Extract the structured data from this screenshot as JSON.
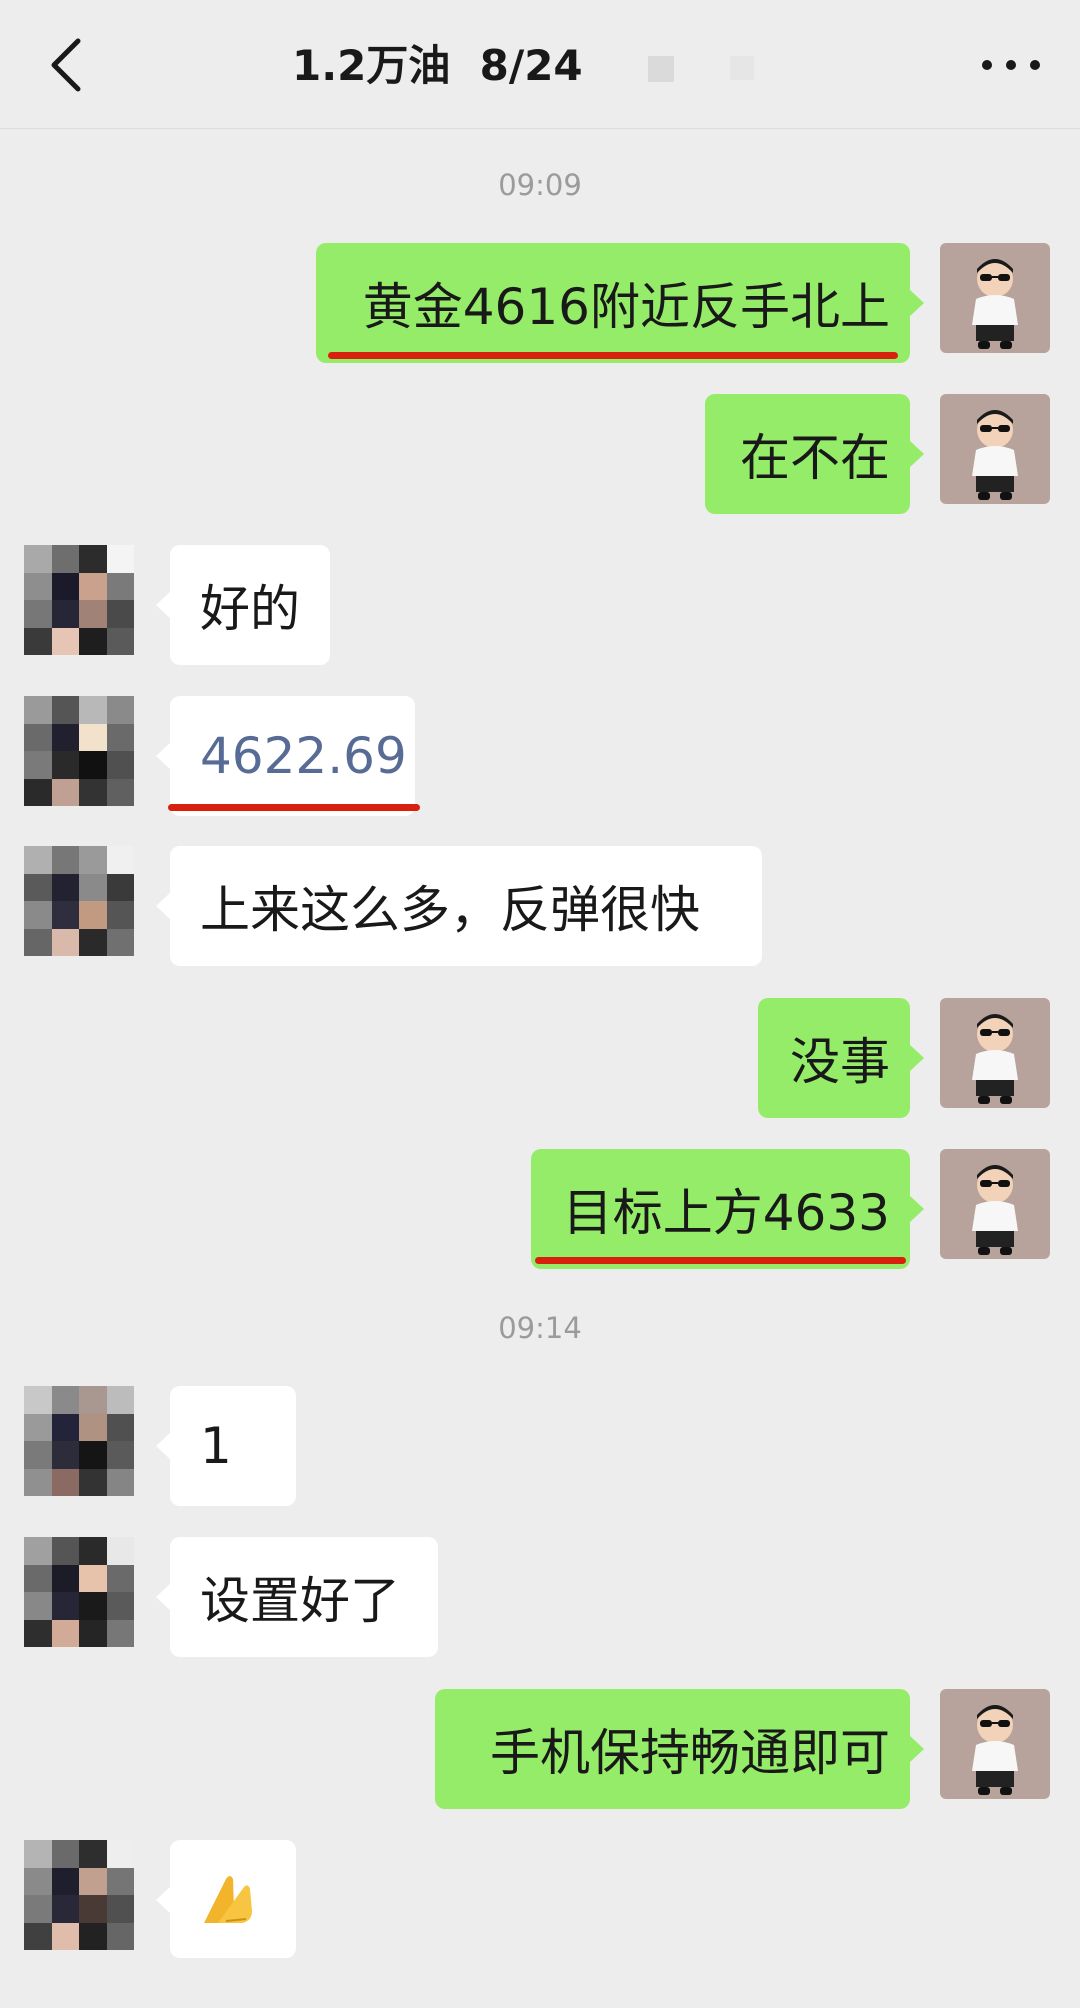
{
  "header": {
    "back_icon": "chevron-left-icon",
    "title": "1.2万油  8/24",
    "more_icon": "more-dots-icon"
  },
  "colors": {
    "sent_bubble": "#95ec69",
    "received_bubble": "#ffffff",
    "background": "#ededed",
    "number_link": "#576b95",
    "highlight_underline": "#d8200e"
  },
  "messages": [
    {
      "kind": "timestamp",
      "text": "09:09"
    },
    {
      "kind": "sent",
      "text": "黄金4616附近反手北上",
      "underlined": true
    },
    {
      "kind": "sent",
      "text": "在不在"
    },
    {
      "kind": "received",
      "text": "好的"
    },
    {
      "kind": "received",
      "text": "4622.69",
      "underlined": true
    },
    {
      "kind": "received",
      "text": "上来这么多，反弹很快"
    },
    {
      "kind": "sent",
      "text": "没事"
    },
    {
      "kind": "sent",
      "text": "目标上方4633",
      "underlined": true
    },
    {
      "kind": "timestamp",
      "text": "09:14"
    },
    {
      "kind": "received",
      "text": "1"
    },
    {
      "kind": "received",
      "text": "设置好了"
    },
    {
      "kind": "sent",
      "text": "手机保持畅通即可"
    },
    {
      "kind": "received",
      "text": "🙏",
      "icon": "praying-hands-emoji-icon"
    }
  ]
}
